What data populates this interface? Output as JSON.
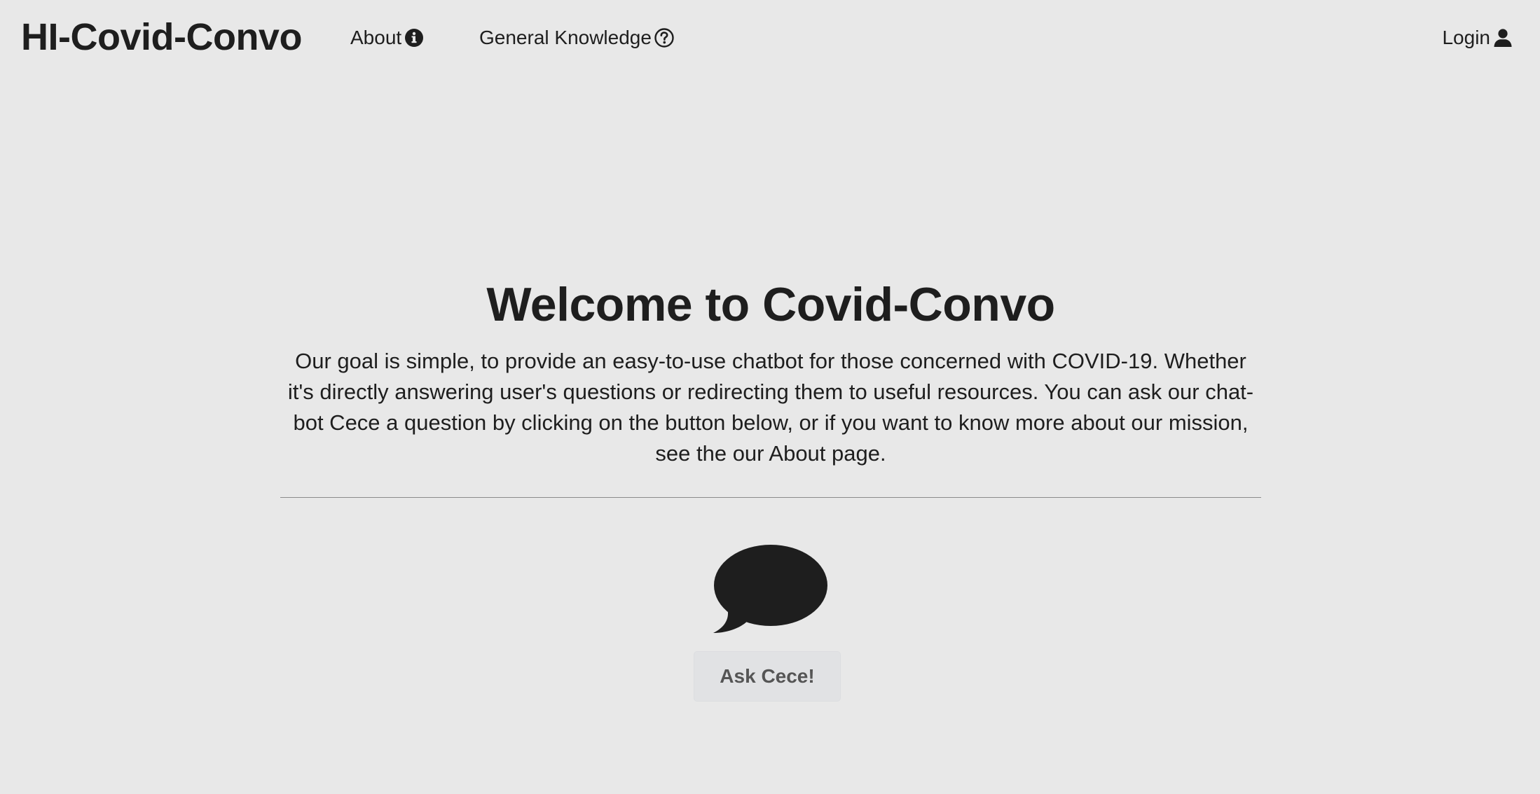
{
  "nav": {
    "brand": "HI-Covid-Convo",
    "about_label": "About",
    "about_icon": "info-circle-icon",
    "general_knowledge_label": "General Knowledge",
    "general_knowledge_icon": "question-circle-icon",
    "login_label": "Login",
    "login_icon": "user-icon"
  },
  "main": {
    "title": "Welcome to Covid-Convo",
    "description": "Our goal is simple, to provide an easy-to-use chatbot for those concerned with COVID-19. Whether it's directly answering user's questions or redirecting them to useful resources. You can ask our chat-bot Cece a question by clicking on the button below, or if you want to know more about our mission, see the our About page.",
    "chat_icon": "chat-bubble-icon",
    "ask_button_label": "Ask Cece!"
  },
  "colors": {
    "background": "#e8e8e8",
    "text": "#1e1e1e",
    "button_background": "#e1e2e4",
    "button_text": "#555555"
  }
}
